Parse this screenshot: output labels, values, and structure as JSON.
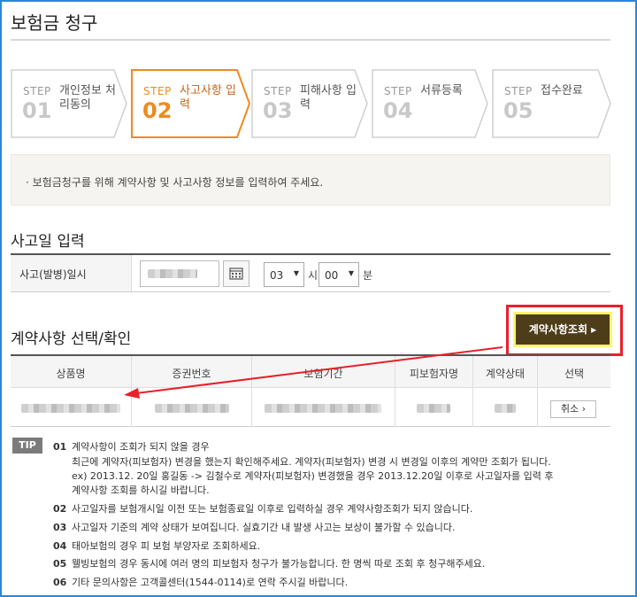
{
  "page": {
    "title": "보험금 청구"
  },
  "steps": [
    {
      "label": "STEP",
      "num": "01",
      "name": "개인정보 처리동의",
      "active": false
    },
    {
      "label": "STEP",
      "num": "02",
      "name": "사고사항 입력",
      "active": true
    },
    {
      "label": "STEP",
      "num": "03",
      "name": "피해사항 입력",
      "active": false
    },
    {
      "label": "STEP",
      "num": "04",
      "name": "서류등록",
      "active": false
    },
    {
      "label": "STEP",
      "num": "05",
      "name": "접수완료",
      "active": false
    }
  ],
  "notice": {
    "text": "·  보험금청구를 위해 계약사항 및 사고사항 정보를 입력하여 주세요."
  },
  "accident": {
    "section_title": "사고일 입력",
    "row_label": "사고(발병)일시",
    "hour": "03",
    "hour_unit": "시",
    "minute": "00",
    "minute_unit": "분"
  },
  "contract": {
    "section_title": "계약사항 선택/확인",
    "lookup_button": "계약사항조회 ▸",
    "columns": [
      "상품명",
      "증권번호",
      "보험기간",
      "피보험자명",
      "계약상태",
      "선택"
    ],
    "cancel_button": "취소 ›"
  },
  "tips": {
    "badge": "TIP",
    "items": [
      {
        "num": "01",
        "lines": [
          "계약사항이 조회가 되지 않을 경우",
          "최근에 계약자(피보험자) 변경을 했는지 확인해주세요. 계약자(피보험자) 변경 시 변경일 이후의 계약만 조회가 됩니다.",
          "ex) 2013.12. 20일 홍길동 -> 김철수로 계약자(피보험자) 변경했을 경우 2013.12.20일 이후로 사고일자를 입력 후",
          "계약사항 조회를 하시길 바랍니다."
        ]
      },
      {
        "num": "02",
        "lines": [
          "사고일자를 보험개시일 이전 또는 보험종료일 이후로 입력하실 경우 계약사항조회가 되지 않습니다."
        ]
      },
      {
        "num": "03",
        "lines": [
          "사고일자 기준의 계약 상태가 보여집니다. 실효기간 내 발생 사고는 보상이 불가할 수 있습니다."
        ]
      },
      {
        "num": "04",
        "lines": [
          "태아보험의 경우 피 보험 부양자로 조회하세요."
        ]
      },
      {
        "num": "05",
        "lines": [
          "웰빙보험의 경우 동시에 여러 명의 피보험자 청구가 불가능합니다. 한 명씩 따로 조회 후 청구해주세요."
        ]
      },
      {
        "num": "06",
        "lines": [
          "기타 문의사항은 고객콜센터(1544-0114)로 연락 주시길 바랍니다."
        ]
      }
    ]
  },
  "colors": {
    "accent": "#ef8a1f",
    "button_dark": "#4e3d19",
    "highlight": "#fff36b",
    "annotation": "#e8202a",
    "frame": "#2b86d8"
  }
}
